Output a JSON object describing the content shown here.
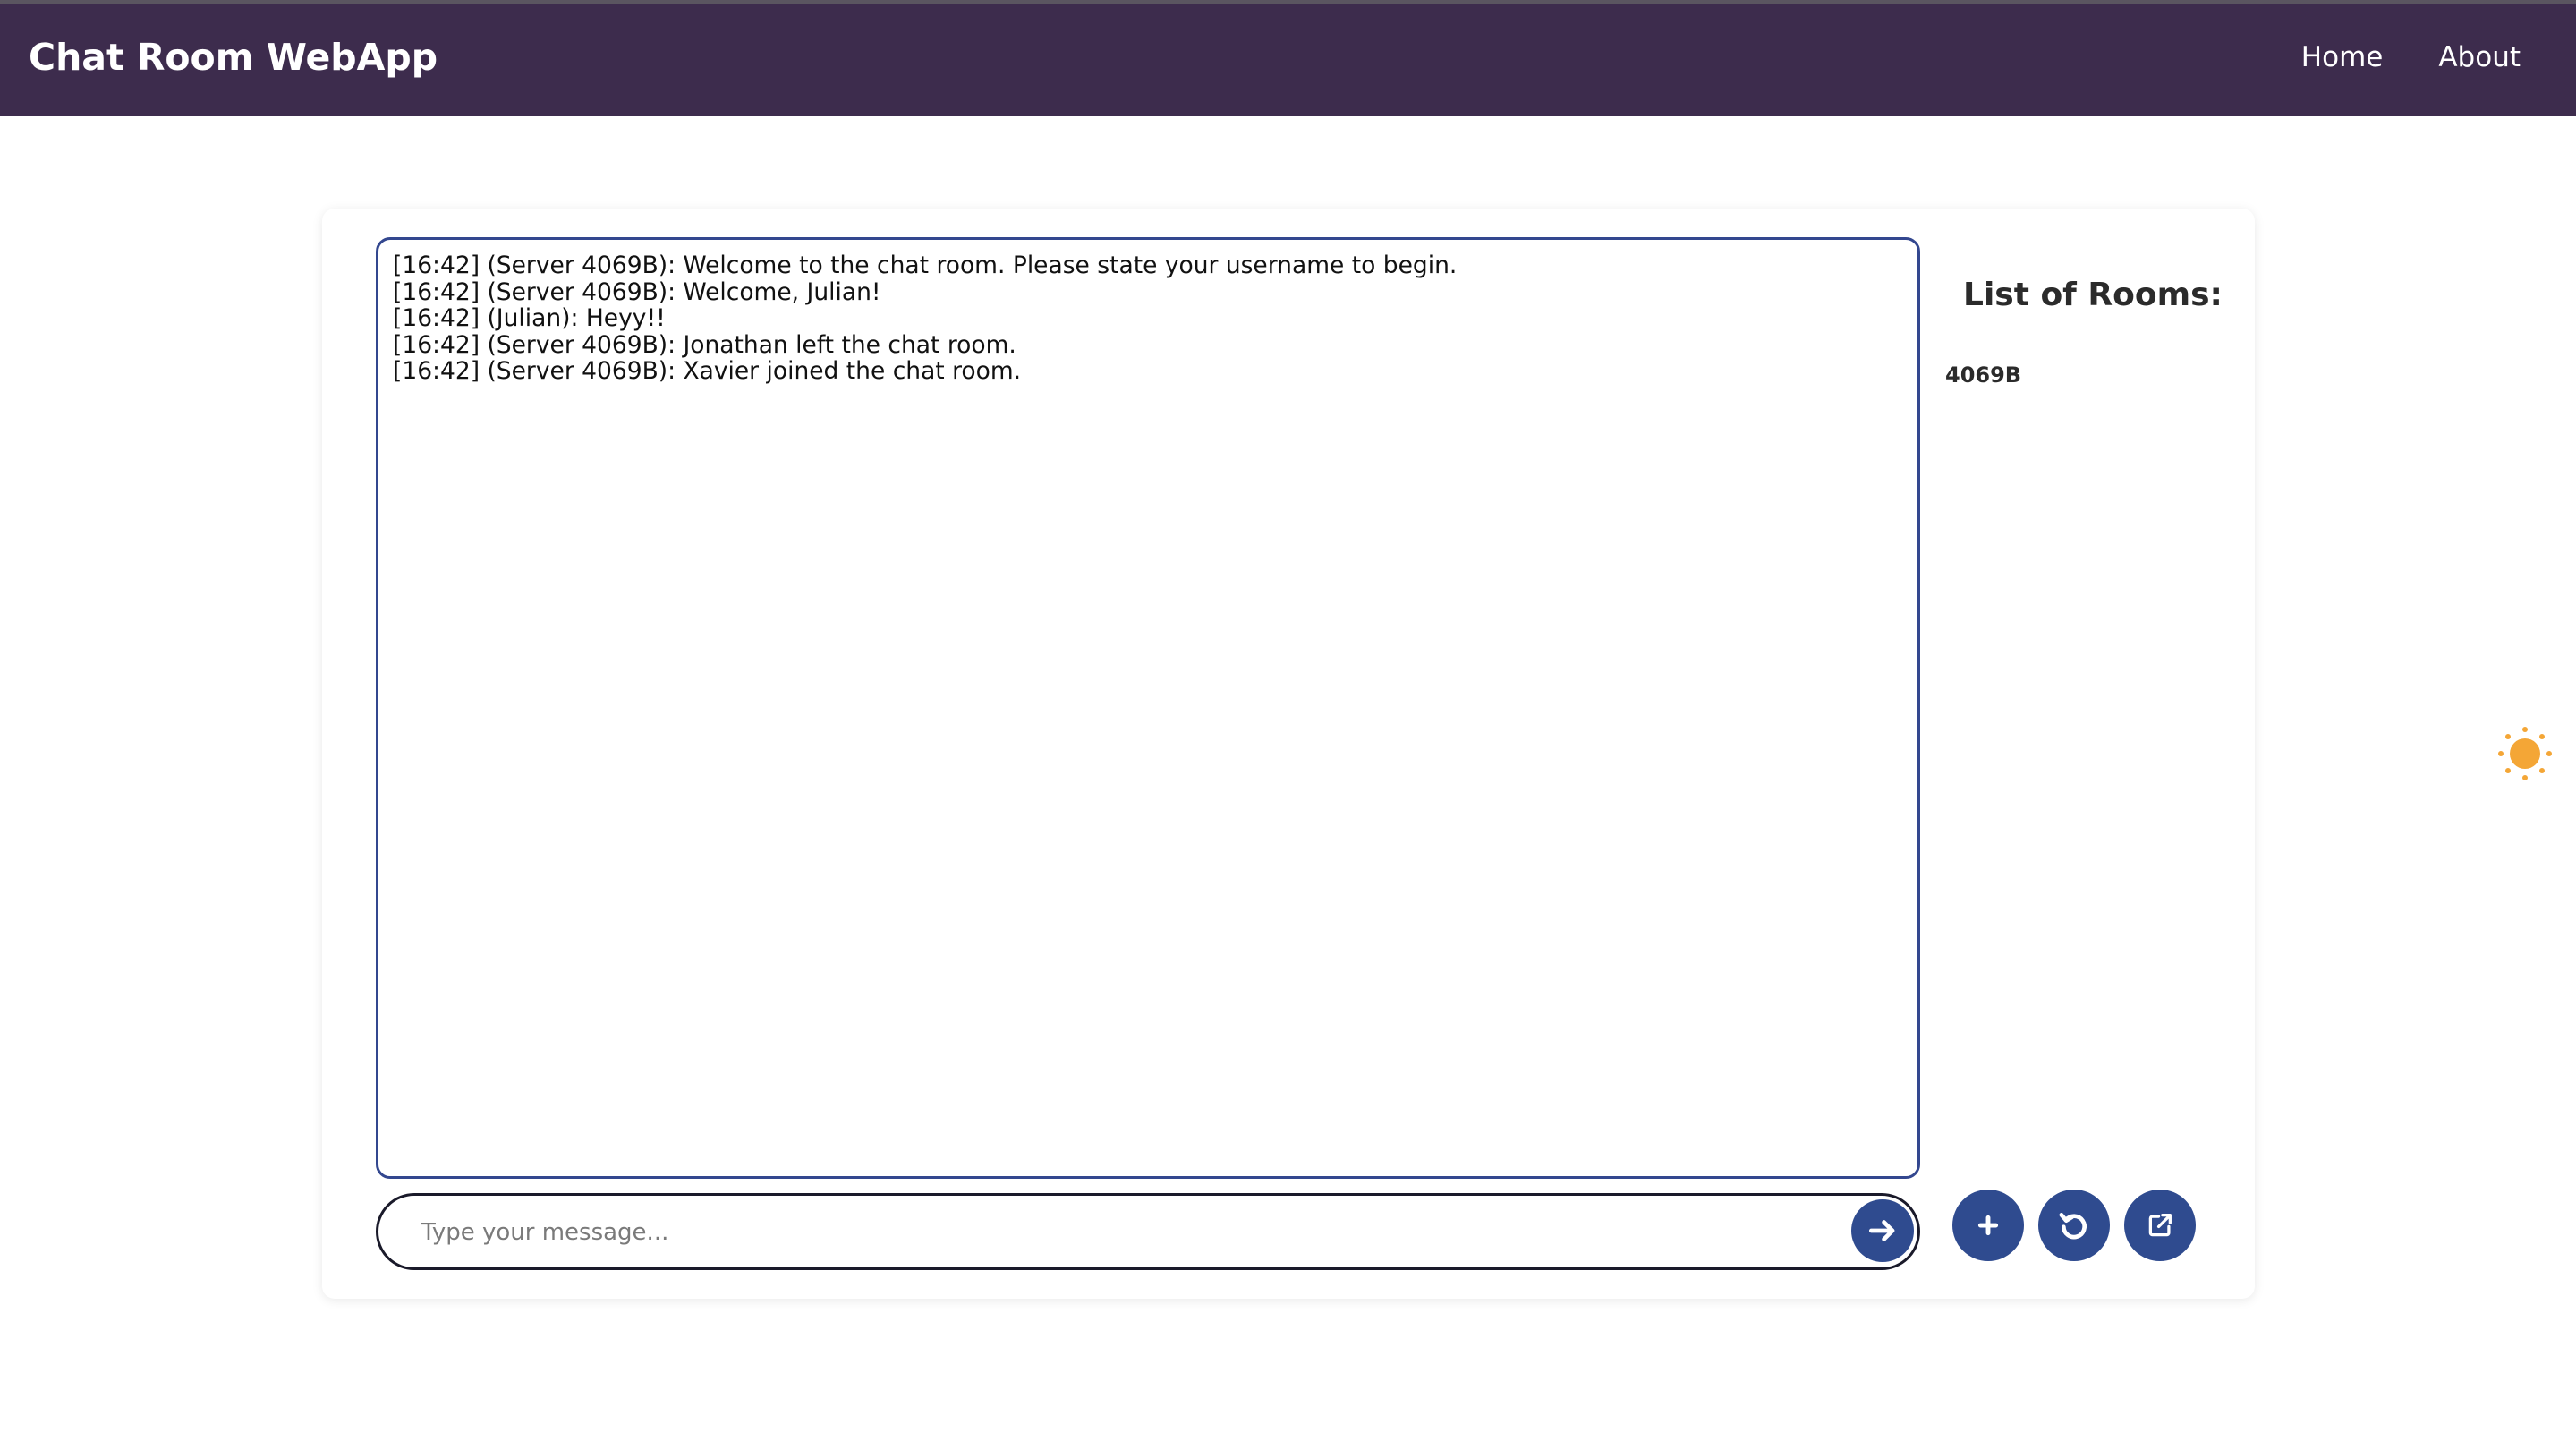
{
  "navbar": {
    "brand": "Chat Room WebApp",
    "links": [
      "Home",
      "About"
    ],
    "background": "#3d2c4d"
  },
  "chat": {
    "messages": [
      "[16:42] (Server 4069B): Welcome to the chat room. Please state your username to begin.",
      "[16:42] (Server 4069B): Welcome, Julian!",
      "[16:42] (Julian): Heyy!!",
      "[16:42] (Server 4069B): Jonathan left the chat room.",
      "[16:42] (Server 4069B): Xavier joined the chat room."
    ],
    "border_color": "#33478f"
  },
  "rooms": {
    "title": "List of Rooms:",
    "items": [
      "4069B"
    ]
  },
  "composer": {
    "placeholder": "Type your message...",
    "value": "",
    "send_icon": "arrow-right-icon"
  },
  "actions": {
    "icons": [
      "plus-icon",
      "refresh-icon",
      "external-link-icon"
    ],
    "color": "#2f4b8f"
  },
  "theme_toggle": {
    "icon": "sun-icon",
    "color": "#f4a636"
  }
}
